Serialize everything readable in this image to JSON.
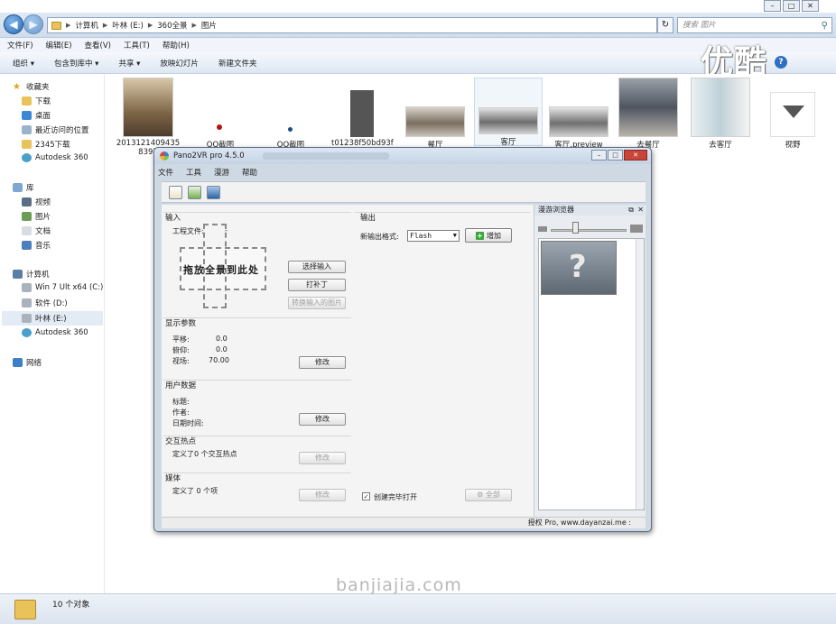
{
  "explorer": {
    "breadcrumbs": [
      "计算机",
      "叶林 (E:)",
      "360全景",
      "图片"
    ],
    "search_placeholder": "搜索 图片",
    "menu": [
      "文件(F)",
      "编辑(E)",
      "查看(V)",
      "工具(T)",
      "帮助(H)"
    ],
    "toolbar": [
      "组织 ▾",
      "包含到库中 ▾",
      "共享 ▾",
      "放映幻灯片",
      "新建文件夹"
    ],
    "nav": {
      "favorites": "收藏夹",
      "favorites_items": [
        "下载",
        "桌面",
        "最近访问的位置",
        "2345下载",
        "Autodesk 360"
      ],
      "libraries": "库",
      "libraries_items": [
        "视频",
        "图片",
        "文档",
        "音乐"
      ],
      "computer": "计算机",
      "computer_items": [
        "Win 7 Ult x64 (C:)",
        "软件 (D:)",
        "叶林 (E:)",
        "Autodesk 360"
      ],
      "network": "网络"
    },
    "thumbs": [
      {
        "caption": "2013121409435",
        "caption2": "8397"
      },
      {
        "caption": "QQ截图"
      },
      {
        "caption": "QQ截图"
      },
      {
        "caption": "t01238f50bd93f"
      },
      {
        "caption": "餐厅"
      },
      {
        "caption": "客厅"
      },
      {
        "caption": "客厅.preview"
      },
      {
        "caption": "去餐厅"
      },
      {
        "caption": "去客厅"
      },
      {
        "caption": "视野"
      }
    ],
    "status": "10 个对象"
  },
  "watermark": {
    "logo": "优酷",
    "site": "banjiajia.com"
  },
  "dialog": {
    "title": "Pano2VR pro 4.5.0",
    "menu": [
      "文件",
      "工具",
      "漫游",
      "帮助"
    ],
    "input": {
      "title": "输入",
      "project_file_label": "工程文件:",
      "project_file_value": "-",
      "drop_text": "拖放全景到此处",
      "select_input": "选择输入",
      "patch": "打补丁",
      "convert": "转换输入的图片"
    },
    "display": {
      "title": "显示参数",
      "pan_label": "平移:",
      "pan_value": "0.0",
      "tilt_label": "俯仰:",
      "tilt_value": "0.0",
      "fov_label": "视场:",
      "fov_value": "70.00",
      "modify": "修改"
    },
    "userdata": {
      "title": "用户数据",
      "title_label": "标题:",
      "author_label": "作者:",
      "datetime_label": "日期时间:",
      "modify": "修改"
    },
    "hotspots": {
      "title": "交互热点",
      "text": "定义了0 个交互热点",
      "modify": "修改"
    },
    "media": {
      "title": "媒体",
      "text": "定义了 0 个项",
      "modify": "修改"
    },
    "output": {
      "title": "输出",
      "format_label": "新输出格式:",
      "format_value": "Flash",
      "add": "增加",
      "open_after_create": "创建完毕打开",
      "all": "全部"
    },
    "browser": {
      "title": "漫游浏览器"
    },
    "status": "授权 Pro, www.dayanzai.me :"
  },
  "colors": {
    "accent": "#2a6bb5",
    "window_frame": "#cfd9e4",
    "close": "#c9453a"
  }
}
